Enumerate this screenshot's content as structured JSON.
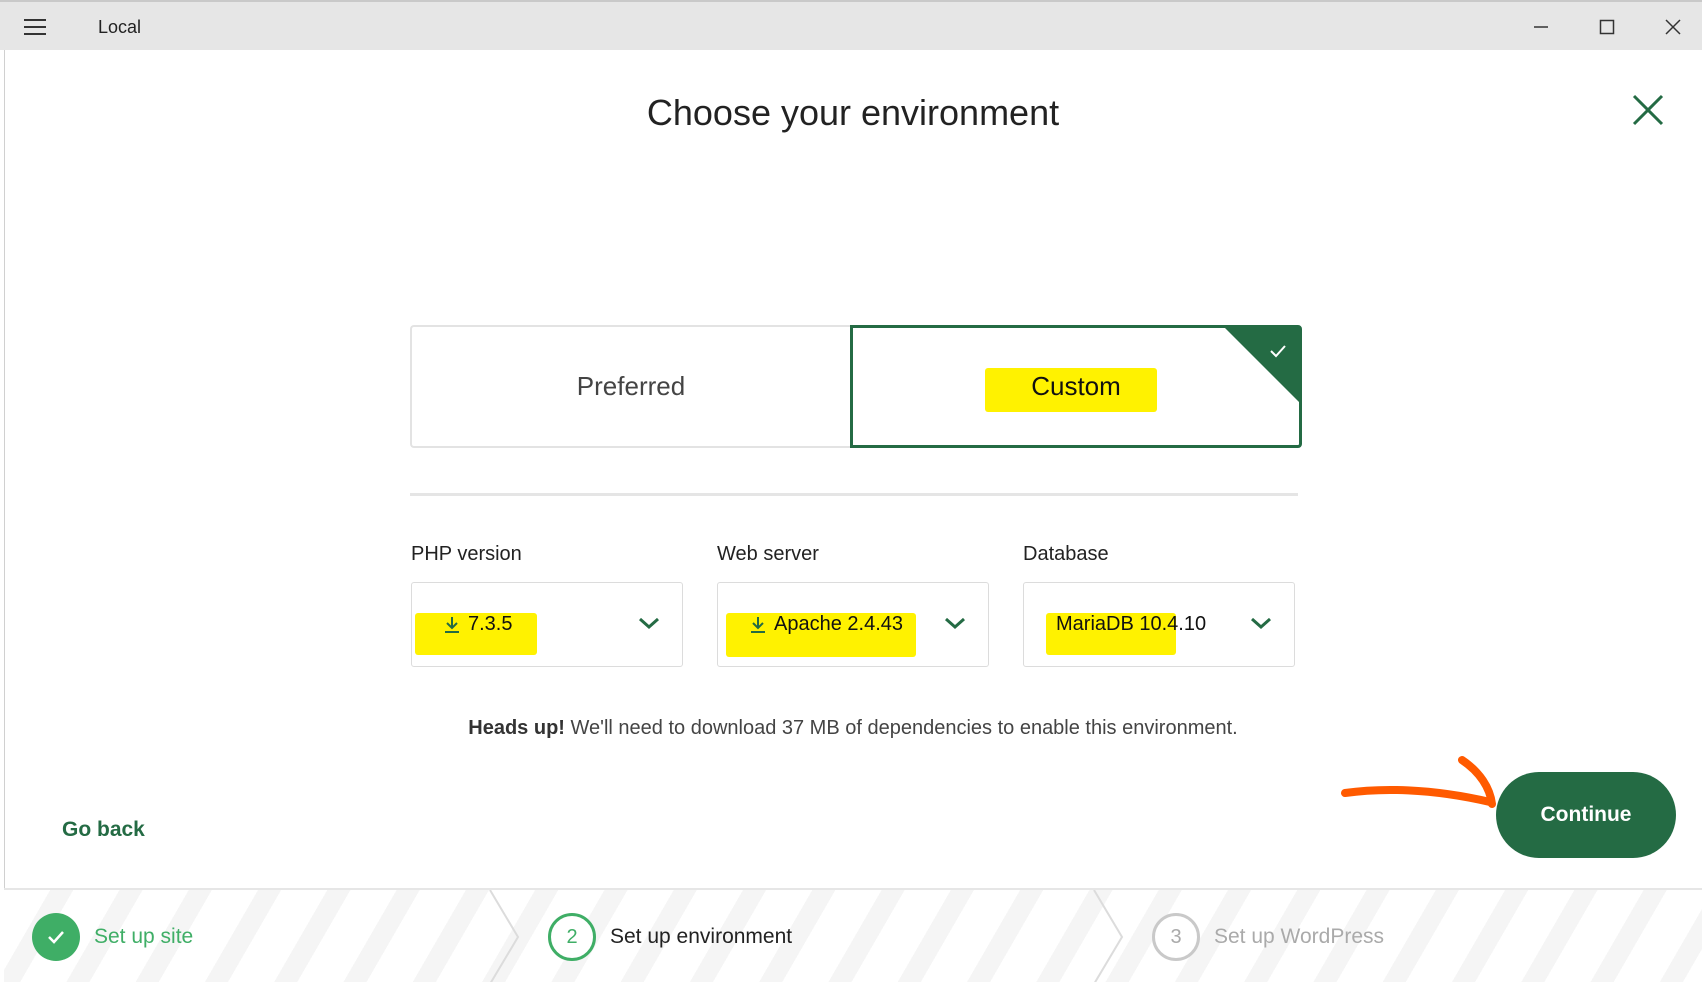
{
  "window": {
    "title": "Local"
  },
  "page": {
    "title": "Choose your environment"
  },
  "environment_toggle": {
    "options": [
      "Preferred",
      "Custom"
    ],
    "selected": "Custom"
  },
  "fields": [
    {
      "label": "PHP version",
      "value": "7.3.5",
      "download_icon": true
    },
    {
      "label": "Web server",
      "value": "Apache 2.4.43",
      "download_icon": true
    },
    {
      "label": "Database",
      "value": "MariaDB 10.4.10",
      "download_icon": false
    }
  ],
  "notice": {
    "strong": "Heads up!",
    "text": " We'll need to download 37 MB of dependencies to enable this environment."
  },
  "actions": {
    "back": "Go back",
    "continue": "Continue"
  },
  "steps": [
    {
      "number": "1",
      "label": "Set up site",
      "state": "done"
    },
    {
      "number": "2",
      "label": "Set up environment",
      "state": "active"
    },
    {
      "number": "3",
      "label": "Set up WordPress",
      "state": "pending"
    }
  ],
  "colors": {
    "brand_green": "#246b44",
    "step_green": "#3fae66",
    "highlight": "#fff200",
    "annotation_arrow": "#ff5a00"
  },
  "icons": [
    "menu-icon",
    "minimize-icon",
    "maximize-icon",
    "close-icon",
    "check-icon",
    "download-icon",
    "chevron-down-icon",
    "arrow-icon"
  ]
}
